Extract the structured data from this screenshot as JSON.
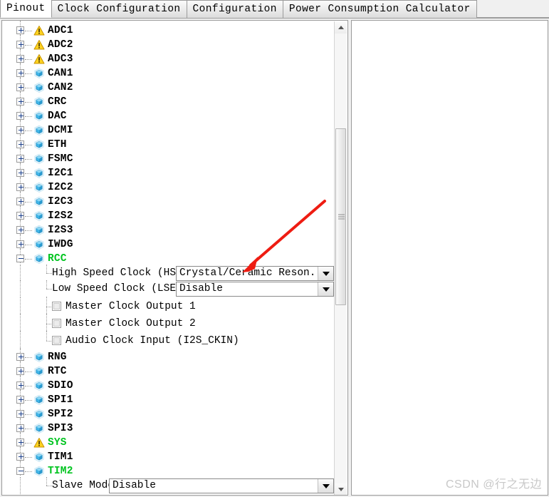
{
  "window": {
    "tabs": [
      {
        "label": "Pinout",
        "active": true
      },
      {
        "label": "Clock Configuration",
        "active": false
      },
      {
        "label": "Configuration",
        "active": false
      },
      {
        "label": "Power Consumption Calculator",
        "active": false
      }
    ]
  },
  "tree": {
    "items": [
      {
        "label": "ADC1",
        "icon": "warning-icon",
        "expander": "plus",
        "green": false
      },
      {
        "label": "ADC2",
        "icon": "warning-icon",
        "expander": "plus",
        "green": false
      },
      {
        "label": "ADC3",
        "icon": "warning-icon",
        "expander": "plus",
        "green": false
      },
      {
        "label": "CAN1",
        "icon": "cube-icon",
        "expander": "plus",
        "green": false
      },
      {
        "label": "CAN2",
        "icon": "cube-icon",
        "expander": "plus",
        "green": false
      },
      {
        "label": "CRC",
        "icon": "cube-icon",
        "expander": "plus",
        "green": false
      },
      {
        "label": "DAC",
        "icon": "cube-icon",
        "expander": "plus",
        "green": false
      },
      {
        "label": "DCMI",
        "icon": "cube-icon",
        "expander": "plus",
        "green": false
      },
      {
        "label": "ETH",
        "icon": "cube-icon",
        "expander": "plus",
        "green": false
      },
      {
        "label": "FSMC",
        "icon": "cube-icon",
        "expander": "plus",
        "green": false
      },
      {
        "label": "I2C1",
        "icon": "cube-icon",
        "expander": "plus",
        "green": false
      },
      {
        "label": "I2C2",
        "icon": "cube-icon",
        "expander": "plus",
        "green": false
      },
      {
        "label": "I2C3",
        "icon": "cube-icon",
        "expander": "plus",
        "green": false
      },
      {
        "label": "I2S2",
        "icon": "cube-icon",
        "expander": "plus",
        "green": false
      },
      {
        "label": "I2S3",
        "icon": "cube-icon",
        "expander": "plus",
        "green": false
      },
      {
        "label": "IWDG",
        "icon": "cube-icon",
        "expander": "plus",
        "green": false
      },
      {
        "label": "RCC",
        "icon": "cube-icon",
        "expander": "minus",
        "green": true
      },
      {
        "label": "RNG",
        "icon": "cube-icon",
        "expander": "plus",
        "green": false
      },
      {
        "label": "RTC",
        "icon": "cube-icon",
        "expander": "plus",
        "green": false
      },
      {
        "label": "SDIO",
        "icon": "cube-icon",
        "expander": "plus",
        "green": false
      },
      {
        "label": "SPI1",
        "icon": "cube-icon",
        "expander": "plus",
        "green": false
      },
      {
        "label": "SPI2",
        "icon": "cube-icon",
        "expander": "plus",
        "green": false
      },
      {
        "label": "SPI3",
        "icon": "cube-icon",
        "expander": "plus",
        "green": false
      },
      {
        "label": "SYS",
        "icon": "warning-icon",
        "expander": "plus",
        "green": true
      },
      {
        "label": "TIM1",
        "icon": "cube-icon",
        "expander": "plus",
        "green": false
      },
      {
        "label": "TIM2",
        "icon": "cube-icon",
        "expander": "minus",
        "green": true
      }
    ],
    "rcc_children": {
      "hse": {
        "label": "High Speed Clock (HSE)",
        "value": "Crystal/Ceramic Reson..."
      },
      "lse": {
        "label": "Low Speed Clock (LSE)",
        "value": "Disable"
      },
      "mco1": {
        "label": "Master Clock Output 1",
        "checked": false
      },
      "mco2": {
        "label": "Master Clock Output 2",
        "checked": false
      },
      "i2sckin": {
        "label": "Audio Clock Input (I2S_CKIN)",
        "checked": false
      }
    },
    "tim2_children": {
      "slave_mode": {
        "label": "Slave Mode",
        "value": "Disable"
      }
    }
  },
  "annotation": {
    "color": "#ee1c12"
  },
  "watermark": {
    "text": "CSDN @行之无边"
  }
}
